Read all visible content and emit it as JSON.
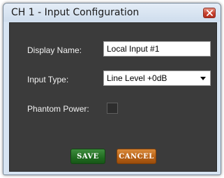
{
  "window": {
    "title": "CH 1 - Input Configuration",
    "close_icon": "close-icon"
  },
  "form": {
    "display_name_label": "Display Name:",
    "display_name_value": "Local Input #1",
    "input_type_label": "Input Type:",
    "input_type_value": "Line Level +0dB",
    "phantom_power_label": "Phantom Power:",
    "phantom_power_checked": false
  },
  "buttons": {
    "save_label": "SAVE",
    "cancel_label": "CANCEL"
  },
  "colors": {
    "panel_background": "#3b3b3b",
    "save_button": "#206b20",
    "cancel_button": "#b55f14",
    "close_button": "#c7402e"
  }
}
